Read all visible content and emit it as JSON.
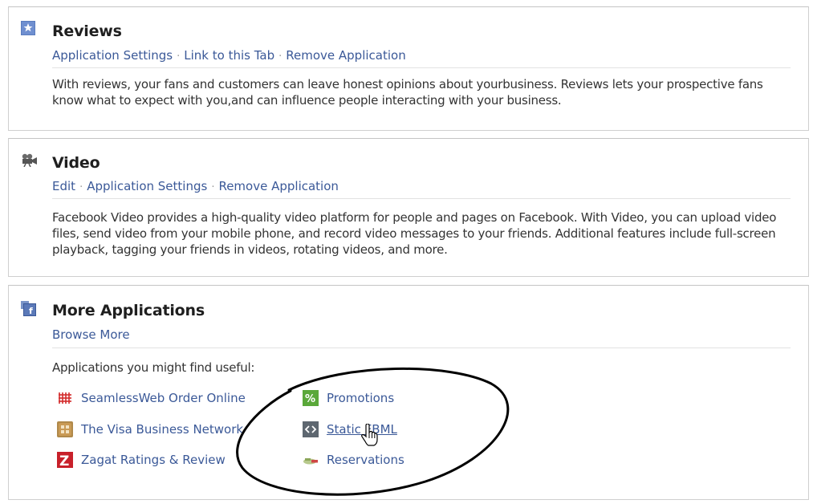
{
  "reviews": {
    "icon": "star-icon",
    "title": "Reviews",
    "links": [
      "Application Settings",
      "Link to this Tab",
      "Remove Application"
    ],
    "description": "With reviews, your fans and customers can leave honest opinions about yourbusiness. Reviews lets your prospective fans know what to expect with you,and can influence people interacting with your business."
  },
  "video": {
    "icon": "video-camera-icon",
    "title": "Video",
    "links": [
      "Edit",
      "Application Settings",
      "Remove Application"
    ],
    "description": "Facebook Video provides a high-quality video platform for people and pages on Facebook. With Video, you can upload video files, send video from your mobile phone, and record video messages to your friends. Additional features include full-screen playback, tagging your friends in videos, rotating videos, and more."
  },
  "more": {
    "icon": "facebook-apps-icon",
    "title": "More Applications",
    "browse_link": "Browse More",
    "intro": "Applications you might find useful:",
    "apps": [
      {
        "label": "SeamlessWeb Order Online",
        "icon": "seamlessweb-icon"
      },
      {
        "label": "The Visa Business Network",
        "icon": "visa-network-icon"
      },
      {
        "label": "Zagat Ratings & Review",
        "icon": "zagat-icon"
      },
      {
        "label": "Promotions",
        "icon": "percent-icon"
      },
      {
        "label": "Static FBML",
        "icon": "code-brackets-icon"
      },
      {
        "label": "Reservations",
        "icon": "reservations-icon"
      }
    ]
  },
  "colors": {
    "link": "#3b5998",
    "text": "#333333",
    "border": "#cfcfcf"
  }
}
